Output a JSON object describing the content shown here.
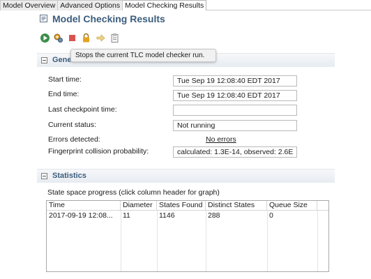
{
  "tabs": [
    {
      "label": "Model Overview"
    },
    {
      "label": "Advanced Options"
    },
    {
      "label": "Model Checking Results"
    }
  ],
  "header": {
    "title": "Model Checking Results",
    "icon": "results-icon"
  },
  "toolbar": {
    "icons": [
      "run-icon",
      "settings-gear-icon",
      "stop-icon",
      "lock-icon",
      "arrow-icon",
      "clipboard-icon"
    ],
    "tooltip": "Stops the current TLC model checker run."
  },
  "general": {
    "title": "General",
    "fields": [
      {
        "label": "Start time:",
        "value": "Tue Sep 19 12:08:40 EDT 2017"
      },
      {
        "label": "End time:",
        "value": "Tue Sep 19 12:08:40 EDT 2017"
      },
      {
        "label": "Last checkpoint time:",
        "value": ""
      },
      {
        "label": "Current status:",
        "value": "Not running"
      }
    ],
    "errors_label": "Errors detected:",
    "errors_value": "No errors",
    "fingerprint_label": "Fingerprint collision probability:",
    "fingerprint_value": "calculated: 1.3E-14,  observed: 2.6E"
  },
  "statistics": {
    "title": "Statistics",
    "caption": "State space progress (click column header for graph)",
    "columns": [
      "Time",
      "Diameter",
      "States Found",
      "Distinct States",
      "Queue Size"
    ],
    "rows": [
      [
        "2017-09-19 12:08...",
        "11",
        "1146",
        "288",
        "0"
      ]
    ]
  },
  "colors": {
    "title": "#3b5d7e",
    "run": "#3c8e4a",
    "stop": "#d9534f",
    "lock": "#e4a21c"
  }
}
